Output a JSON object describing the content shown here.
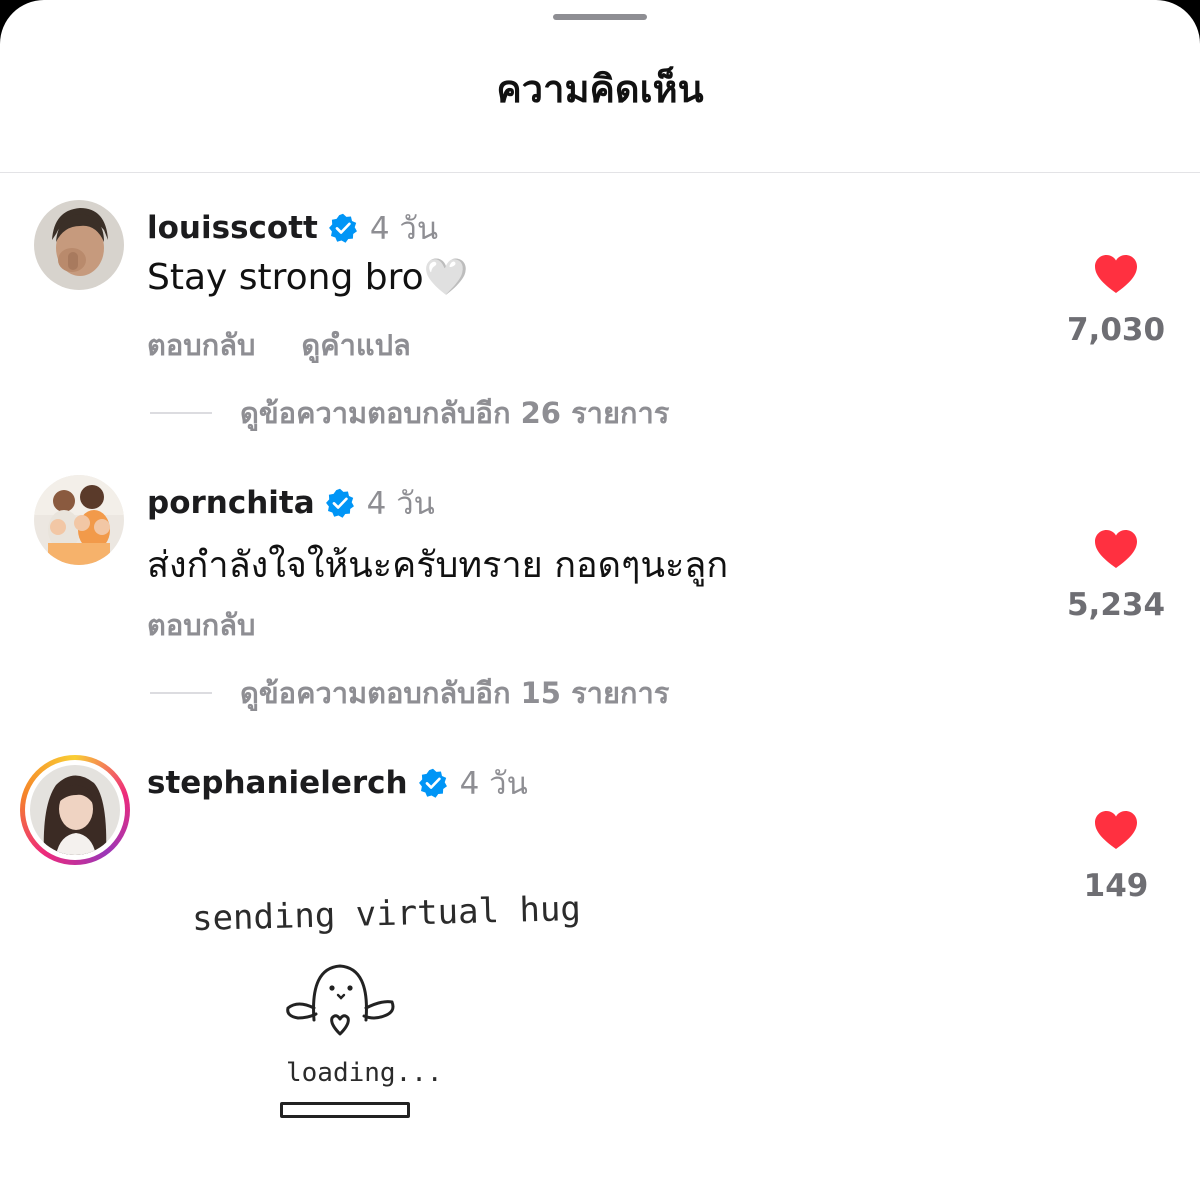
{
  "sheet": {
    "title": "ความคิดเห็น"
  },
  "colors": {
    "like_red": "#ff3040",
    "verified_blue": "#0095f6",
    "secondary_text": "#8e8e93"
  },
  "comments": [
    {
      "username": "louisscott",
      "verified": true,
      "time": "4 วัน",
      "text": "Stay strong bro🤍",
      "actions": [
        "ตอบกลับ",
        "ดูคำแปล"
      ],
      "view_replies": "ดูข้อความตอบกลับอีก 26 รายการ",
      "likes": "7,030",
      "liked": true
    },
    {
      "username": "pornchita",
      "verified": true,
      "time": "4 วัน",
      "text": "ส่งกำลังใจให้นะครับทราย กอดๆนะลูก",
      "actions": [
        "ตอบกลับ"
      ],
      "view_replies": "ดูข้อความตอบกลับอีก 15 รายการ",
      "likes": "5,234",
      "liked": true
    },
    {
      "username": "stephanielerch",
      "verified": true,
      "time": "4 วัน",
      "sticker": {
        "caption": "sending virtual hug",
        "loading": "loading...",
        "icon": "ghost-hug-icon",
        "progress": 0
      },
      "likes": "149",
      "liked": true
    }
  ]
}
